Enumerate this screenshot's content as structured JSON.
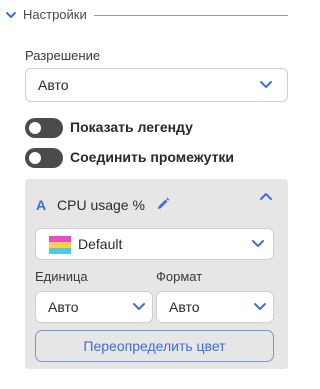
{
  "section": {
    "title": "Настройки"
  },
  "resolution": {
    "label": "Разрешение",
    "value": "Авто"
  },
  "toggles": [
    {
      "label": "Показать легенду",
      "on": false
    },
    {
      "label": "Соединить промежутки",
      "on": false
    }
  ],
  "series": {
    "icon_letter": "A",
    "name": "CPU usage %",
    "palette": {
      "value": "Default",
      "swatch_colors": [
        "#e94cc4",
        "#f5d24a",
        "#4fc9e6"
      ]
    },
    "unit": {
      "label": "Единица",
      "value": "Авто"
    },
    "format": {
      "label": "Формат",
      "value": "Авто"
    },
    "override_color_label": "Переопределить цвет"
  },
  "colors": {
    "accent": "#3f6fd6",
    "card_bg": "#e6e6e6",
    "toggle_off": "#4b4b4b"
  }
}
